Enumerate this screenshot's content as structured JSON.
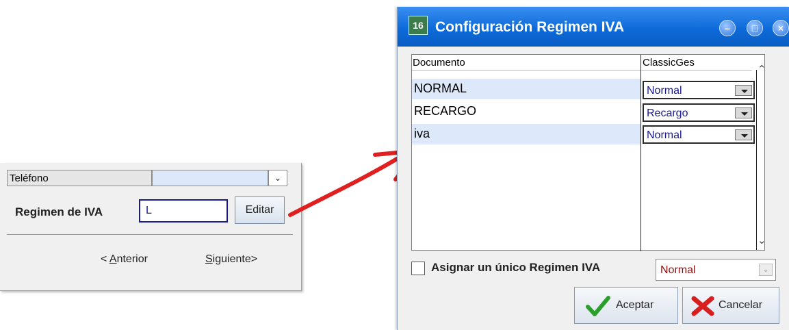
{
  "left_form": {
    "phone_label": "Teléfono",
    "phone_value": "",
    "vat_label": "Regimen de IVA",
    "vat_value": "L",
    "edit_label": "Editar",
    "prev_prefix": "< ",
    "prev_mnemonic": "A",
    "prev_rest": "nterior",
    "next_mnemonic": "S",
    "next_rest": "iguiente>"
  },
  "dialog": {
    "title": "Configuración Regimen IVA",
    "icon_text": "16",
    "columns": [
      "Documento",
      "ClassicGes"
    ],
    "rows": [
      {
        "documento": "NORMAL",
        "classicges": "Normal"
      },
      {
        "documento": "RECARGO",
        "classicges": "Recargo"
      },
      {
        "documento": "iva",
        "classicges": "Normal"
      }
    ],
    "single_checkbox_label": "Asignar un único Regimen IVA",
    "single_checkbox_checked": false,
    "single_value": "Normal",
    "ok_label": "Aceptar",
    "cancel_label": "Cancelar"
  },
  "colors": {
    "title_bar": "#0d6bd9",
    "row_highlight": "#dde8fa",
    "arrow": "#e02020",
    "select_text": "#1a1a8c"
  },
  "icons": [
    "chevron-down-icon",
    "arrow-icon",
    "app-icon",
    "minimize-icon",
    "maximize-icon",
    "close-icon",
    "check-icon",
    "x-icon"
  ]
}
